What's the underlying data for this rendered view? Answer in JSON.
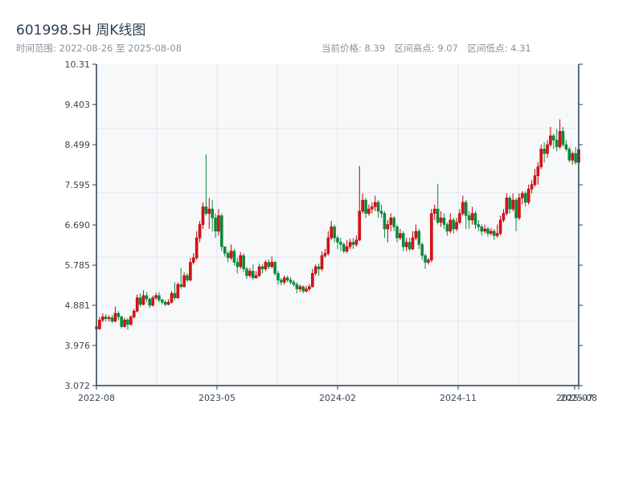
{
  "header": {
    "title": "601998.SH 周K线图",
    "range_text": "时间范围: 2022-08-26 至 2025-08-08",
    "current_price": "当前价格: 8.39",
    "period_high": "区间高点: 9.07",
    "period_low": "区间低点: 4.31"
  },
  "colors": {
    "up": "#d7141a",
    "up_border": "#c00000",
    "down": "#0b8a3c",
    "background": "#f7f8fa",
    "grid": "#e2e5ea",
    "axis": "#2c3e50"
  },
  "chart_data": {
    "type": "candlestick",
    "title": "601998.SH 周K线图",
    "frequency": "weekly",
    "ylim": [
      3.072,
      10.31
    ],
    "y_ticks": [
      "3.072",
      "3.976",
      "4.881",
      "5.785",
      "6.690",
      "7.595",
      "8.499",
      "9.403",
      "10.31"
    ],
    "x_ticks": [
      "2022-08",
      "2023-05",
      "2024-02",
      "2024-11",
      "2025-07",
      "2025-08"
    ],
    "grid": true,
    "ohlc_order": [
      "open",
      "high",
      "low",
      "close"
    ],
    "ohlc": [
      [
        4.4,
        4.45,
        4.31,
        4.35
      ],
      [
        4.35,
        4.62,
        4.33,
        4.55
      ],
      [
        4.55,
        4.7,
        4.5,
        4.62
      ],
      [
        4.62,
        4.68,
        4.52,
        4.58
      ],
      [
        4.58,
        4.66,
        4.52,
        4.6
      ],
      [
        4.6,
        4.66,
        4.48,
        4.52
      ],
      [
        4.52,
        4.85,
        4.5,
        4.7
      ],
      [
        4.7,
        4.75,
        4.55,
        4.62
      ],
      [
        4.62,
        4.65,
        4.36,
        4.4
      ],
      [
        4.4,
        4.6,
        4.38,
        4.55
      ],
      [
        4.55,
        4.6,
        4.33,
        4.45
      ],
      [
        4.45,
        4.66,
        4.42,
        4.62
      ],
      [
        4.62,
        4.8,
        4.58,
        4.75
      ],
      [
        4.75,
        5.12,
        4.72,
        5.05
      ],
      [
        5.05,
        5.15,
        4.85,
        4.9
      ],
      [
        4.9,
        5.22,
        4.88,
        5.1
      ],
      [
        5.1,
        5.18,
        4.95,
        5.02
      ],
      [
        5.02,
        5.06,
        4.82,
        4.88
      ],
      [
        4.88,
        5.1,
        4.85,
        5.05
      ],
      [
        5.05,
        5.16,
        5.0,
        5.1
      ],
      [
        5.1,
        5.18,
        4.95,
        5.0
      ],
      [
        5.0,
        5.04,
        4.9,
        4.95
      ],
      [
        4.95,
        5.0,
        4.86,
        4.9
      ],
      [
        4.9,
        5.02,
        4.88,
        4.95
      ],
      [
        4.95,
        5.2,
        4.92,
        5.15
      ],
      [
        5.15,
        5.4,
        5.0,
        5.05
      ],
      [
        5.05,
        5.4,
        5.02,
        5.35
      ],
      [
        5.35,
        5.72,
        5.25,
        5.3
      ],
      [
        5.3,
        5.62,
        5.28,
        5.55
      ],
      [
        5.55,
        5.6,
        5.4,
        5.45
      ],
      [
        5.45,
        5.95,
        5.42,
        5.85
      ],
      [
        5.85,
        6.05,
        5.8,
        5.95
      ],
      [
        5.95,
        6.55,
        5.9,
        6.4
      ],
      [
        6.4,
        6.78,
        6.3,
        6.7
      ],
      [
        6.7,
        7.2,
        6.6,
        7.1
      ],
      [
        7.1,
        8.28,
        6.9,
        6.95
      ],
      [
        6.95,
        7.3,
        6.6,
        7.05
      ],
      [
        7.05,
        7.25,
        6.55,
        6.85
      ],
      [
        6.85,
        6.95,
        6.4,
        6.55
      ],
      [
        6.55,
        7.05,
        6.45,
        6.9
      ],
      [
        6.9,
        6.95,
        6.1,
        6.2
      ],
      [
        6.2,
        6.2,
        5.98,
        6.05
      ],
      [
        6.05,
        6.1,
        5.85,
        5.95
      ],
      [
        5.95,
        6.25,
        5.9,
        6.1
      ],
      [
        6.1,
        6.15,
        5.78,
        5.85
      ],
      [
        5.85,
        5.95,
        5.6,
        5.75
      ],
      [
        5.75,
        6.08,
        5.7,
        6.0
      ],
      [
        6.0,
        6.05,
        5.62,
        5.7
      ],
      [
        5.7,
        5.75,
        5.48,
        5.55
      ],
      [
        5.55,
        5.72,
        5.5,
        5.65
      ],
      [
        5.65,
        5.8,
        5.45,
        5.5
      ],
      [
        5.5,
        5.65,
        5.48,
        5.55
      ],
      [
        5.55,
        5.82,
        5.52,
        5.75
      ],
      [
        5.75,
        5.8,
        5.6,
        5.7
      ],
      [
        5.7,
        5.9,
        5.65,
        5.85
      ],
      [
        5.85,
        5.92,
        5.7,
        5.75
      ],
      [
        5.75,
        5.98,
        5.72,
        5.85
      ],
      [
        5.85,
        5.88,
        5.55,
        5.6
      ],
      [
        5.6,
        5.65,
        5.35,
        5.45
      ],
      [
        5.45,
        5.5,
        5.33,
        5.4
      ],
      [
        5.4,
        5.55,
        5.35,
        5.5
      ],
      [
        5.5,
        5.55,
        5.4,
        5.45
      ],
      [
        5.45,
        5.52,
        5.35,
        5.4
      ],
      [
        5.4,
        5.45,
        5.3,
        5.35
      ],
      [
        5.35,
        5.4,
        5.15,
        5.25
      ],
      [
        5.25,
        5.35,
        5.18,
        5.3
      ],
      [
        5.3,
        5.33,
        5.15,
        5.2
      ],
      [
        5.2,
        5.32,
        5.17,
        5.25
      ],
      [
        5.25,
        5.36,
        5.2,
        5.3
      ],
      [
        5.3,
        5.7,
        5.28,
        5.6
      ],
      [
        5.6,
        5.8,
        5.55,
        5.75
      ],
      [
        5.75,
        5.82,
        5.55,
        5.7
      ],
      [
        5.7,
        6.1,
        5.65,
        6.0
      ],
      [
        6.0,
        6.15,
        5.95,
        6.05
      ],
      [
        6.05,
        6.55,
        6.0,
        6.4
      ],
      [
        6.4,
        6.78,
        6.35,
        6.65
      ],
      [
        6.65,
        6.7,
        6.3,
        6.4
      ],
      [
        6.4,
        6.45,
        6.15,
        6.3
      ],
      [
        6.3,
        6.4,
        6.1,
        6.25
      ],
      [
        6.25,
        6.3,
        6.05,
        6.1
      ],
      [
        6.1,
        6.35,
        6.05,
        6.2
      ],
      [
        6.2,
        6.38,
        6.15,
        6.3
      ],
      [
        6.3,
        6.4,
        6.15,
        6.25
      ],
      [
        6.25,
        6.45,
        6.2,
        6.35
      ],
      [
        6.35,
        8.02,
        6.33,
        7.0
      ],
      [
        7.0,
        7.4,
        6.95,
        7.25
      ],
      [
        7.25,
        7.3,
        6.85,
        6.95
      ],
      [
        6.95,
        7.15,
        6.9,
        7.05
      ],
      [
        7.05,
        7.2,
        6.95,
        7.1
      ],
      [
        7.1,
        7.35,
        7.0,
        7.2
      ],
      [
        7.2,
        7.25,
        6.85,
        7.0
      ],
      [
        7.0,
        7.15,
        6.85,
        6.95
      ],
      [
        6.95,
        7.0,
        6.4,
        6.6
      ],
      [
        6.6,
        6.8,
        6.3,
        6.7
      ],
      [
        6.7,
        6.95,
        6.55,
        6.85
      ],
      [
        6.85,
        6.9,
        6.55,
        6.65
      ],
      [
        6.65,
        6.7,
        6.3,
        6.4
      ],
      [
        6.4,
        6.6,
        6.35,
        6.5
      ],
      [
        6.5,
        6.55,
        6.1,
        6.2
      ],
      [
        6.2,
        6.4,
        6.1,
        6.3
      ],
      [
        6.3,
        6.4,
        6.1,
        6.15
      ],
      [
        6.15,
        6.55,
        6.12,
        6.4
      ],
      [
        6.4,
        6.7,
        6.35,
        6.55
      ],
      [
        6.55,
        6.6,
        6.15,
        6.25
      ],
      [
        6.25,
        6.3,
        5.9,
        6.0
      ],
      [
        6.0,
        6.05,
        5.7,
        5.85
      ],
      [
        5.85,
        5.95,
        5.8,
        5.9
      ],
      [
        5.9,
        7.05,
        5.85,
        6.95
      ],
      [
        6.95,
        7.15,
        6.8,
        7.05
      ],
      [
        7.05,
        7.62,
        6.7,
        6.75
      ],
      [
        6.75,
        7.0,
        6.65,
        6.85
      ],
      [
        6.85,
        6.95,
        6.6,
        6.7
      ],
      [
        6.7,
        6.75,
        6.45,
        6.55
      ],
      [
        6.55,
        6.95,
        6.5,
        6.8
      ],
      [
        6.8,
        6.85,
        6.5,
        6.6
      ],
      [
        6.6,
        6.85,
        6.55,
        6.75
      ],
      [
        6.75,
        7.05,
        6.7,
        6.95
      ],
      [
        6.95,
        7.35,
        6.9,
        7.2
      ],
      [
        7.2,
        7.25,
        6.6,
        6.9
      ],
      [
        6.9,
        7.0,
        6.6,
        6.8
      ],
      [
        6.8,
        7.1,
        6.7,
        6.95
      ],
      [
        6.95,
        7.0,
        6.6,
        6.7
      ],
      [
        6.7,
        6.8,
        6.55,
        6.65
      ],
      [
        6.65,
        6.7,
        6.45,
        6.55
      ],
      [
        6.55,
        6.7,
        6.5,
        6.6
      ],
      [
        6.6,
        6.65,
        6.42,
        6.5
      ],
      [
        6.5,
        6.62,
        6.45,
        6.55
      ],
      [
        6.55,
        6.6,
        6.35,
        6.45
      ],
      [
        6.45,
        6.7,
        6.4,
        6.5
      ],
      [
        6.5,
        6.9,
        6.45,
        6.8
      ],
      [
        6.8,
        7.05,
        6.75,
        6.95
      ],
      [
        6.95,
        7.4,
        6.9,
        7.3
      ],
      [
        7.3,
        7.35,
        6.95,
        7.05
      ],
      [
        7.05,
        7.4,
        7.0,
        7.25
      ],
      [
        7.25,
        7.3,
        6.55,
        6.85
      ],
      [
        6.85,
        7.4,
        6.8,
        7.3
      ],
      [
        7.3,
        7.45,
        7.15,
        7.4
      ],
      [
        7.4,
        7.45,
        7.1,
        7.2
      ],
      [
        7.2,
        7.6,
        7.15,
        7.5
      ],
      [
        7.5,
        7.7,
        7.4,
        7.6
      ],
      [
        7.6,
        7.95,
        7.55,
        7.8
      ],
      [
        7.8,
        8.1,
        7.6,
        8.0
      ],
      [
        8.0,
        8.5,
        7.95,
        8.4
      ],
      [
        8.4,
        8.55,
        8.1,
        8.3
      ],
      [
        8.3,
        8.6,
        8.2,
        8.5
      ],
      [
        8.5,
        8.9,
        8.45,
        8.7
      ],
      [
        8.7,
        8.75,
        8.4,
        8.6
      ],
      [
        8.6,
        8.85,
        8.35,
        8.45
      ],
      [
        8.45,
        9.07,
        8.4,
        8.8
      ],
      [
        8.8,
        8.9,
        8.45,
        8.5
      ],
      [
        8.5,
        8.6,
        8.35,
        8.4
      ],
      [
        8.4,
        8.45,
        8.1,
        8.15
      ],
      [
        8.15,
        8.35,
        8.05,
        8.3
      ],
      [
        8.3,
        8.45,
        8.05,
        8.1
      ],
      [
        8.1,
        8.45,
        8.08,
        8.39
      ]
    ]
  }
}
